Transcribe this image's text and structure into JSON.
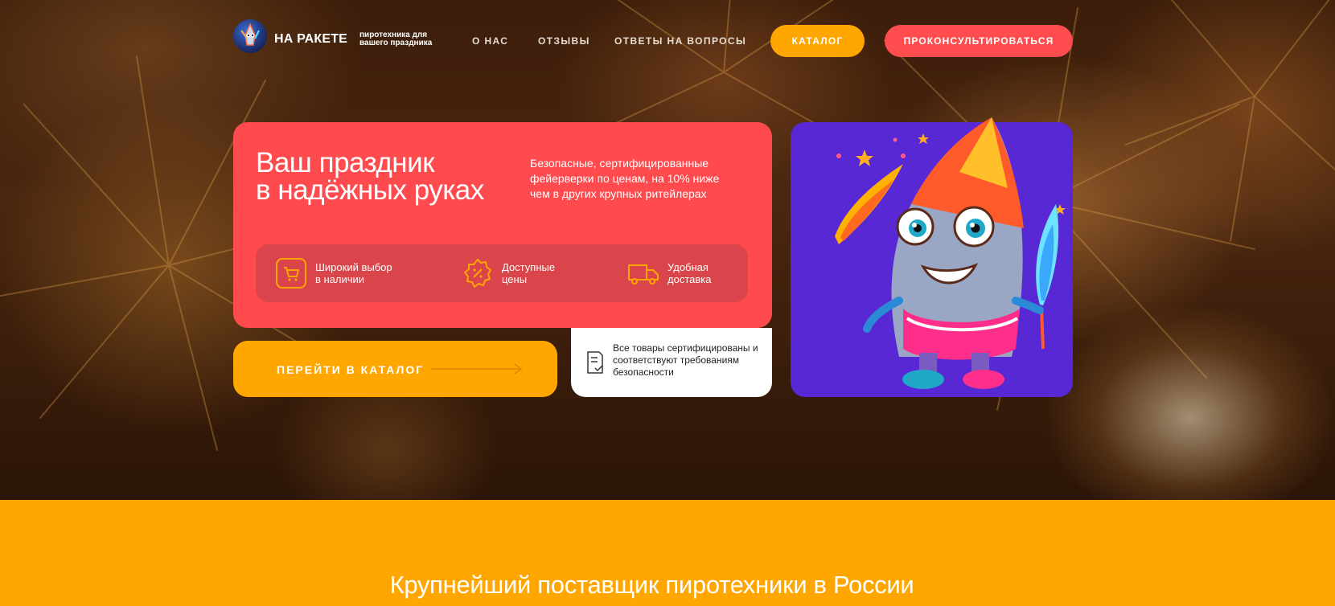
{
  "header": {
    "logo_icon": "rocket-mascot-logo-icon",
    "brand_name": "НА РАКЕТЕ",
    "brand_tagline_1": "пиротехника для",
    "brand_tagline_2": "вашего праздника",
    "nav": [
      {
        "label": "О НАС"
      },
      {
        "label": "ОТЗЫВЫ"
      },
      {
        "label": "ОТВЕТЫ НА ВОПРОСЫ"
      }
    ],
    "catalog_label": "КАТАЛОГ",
    "consult_label": "ПРОКОНСУЛЬТИРОВАТЬСЯ"
  },
  "hero": {
    "title_line_1": "Ваш праздник",
    "title_line_2": "в надёжных руках",
    "subtitle": "Безопасные, сертифицированные фейерверки по ценам, на 10% ниже чем в других крупных ритейлерах",
    "features": [
      {
        "icon": "cart-icon",
        "line_1": "Широкий выбор",
        "line_2": "в наличии"
      },
      {
        "icon": "discount-badge-icon",
        "line_1": "Доступные",
        "line_2": "цены"
      },
      {
        "icon": "truck-icon",
        "line_1": "Удобная",
        "line_2": "доставка"
      }
    ],
    "go_catalog_label": "ПЕРЕЙТИ В КАТАЛОГ",
    "certificate_text": "Все товары сертифицированы и соответствуют требованиям безопасности",
    "mascot_icon": "rocket-mascot-illustration"
  },
  "band": {
    "title": "Крупнейший поставщик пиротехники в России"
  },
  "colors": {
    "accent_orange": "#ffa600",
    "accent_red": "#ff4a4e",
    "mascot_bg": "#5728d4"
  }
}
